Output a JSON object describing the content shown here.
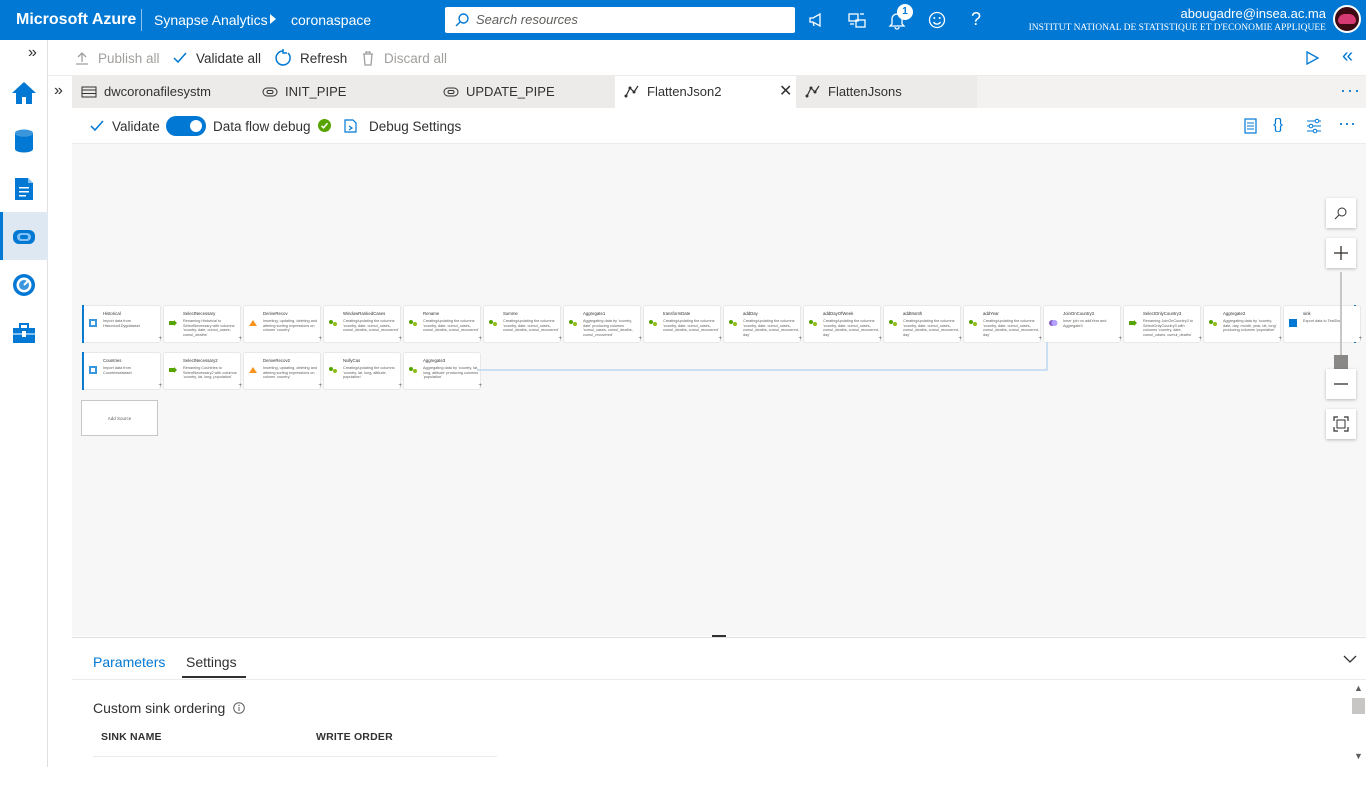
{
  "topbar": {
    "brand": "Microsoft Azure",
    "service": "Synapse Analytics",
    "workspace": "coronaspace",
    "search_placeholder": "Search resources",
    "notification_count": "1",
    "user_email": "abougadre@insea.ac.ma",
    "user_org": "INSTITUT NATIONAL DE STATISTIQUE ET D'ECONOMIE APPLIQUEE",
    "help_label": "?"
  },
  "commands": {
    "publish_all": "Publish all",
    "validate_all": "Validate all",
    "refresh": "Refresh",
    "discard_all": "Discard all"
  },
  "tabs": [
    {
      "label": "dwcoronafilesystm",
      "icon": "dataset-icon",
      "active": false
    },
    {
      "label": "INIT_PIPE",
      "icon": "pipeline-icon",
      "active": false
    },
    {
      "label": "UPDATE_PIPE",
      "icon": "pipeline-icon",
      "active": false
    },
    {
      "label": "FlattenJson2",
      "icon": "dataflow-icon",
      "active": true
    },
    {
      "label": "FlattenJsons",
      "icon": "dataflow-icon",
      "active": false
    }
  ],
  "dataflow_toolbar": {
    "validate": "Validate",
    "debug_label": "Data flow debug",
    "debug_on": true,
    "debug_settings": "Debug Settings"
  },
  "flow_row1": [
    {
      "name": "Historical",
      "desc": "Import data from Historical1Dygdataset"
    },
    {
      "name": "SelectNecessary",
      "desc": "Renaming Historical to SelectNecessary with columns 'country, date, cumul_cases, cumul_deaths'"
    },
    {
      "name": "DeriveRecov",
      "desc": "Inserting, updating, deleting and altering sorting expressions on column 'country'"
    },
    {
      "name": "WindowRankedCases",
      "desc": "Creating/updating the columns 'country, date, cumul_cases, cumul_deaths, cumul_recovered'"
    },
    {
      "name": "Rename",
      "desc": "Creating/updating the columns 'country, date, cumul_cases, cumul_deaths, cumul_recovered'"
    },
    {
      "name": "Summe",
      "desc": "Creating/updating the columns 'country, date, cumul_cases, cumul_deaths, cumul_recovered'"
    },
    {
      "name": "Aggregate1",
      "desc": "Aggregating data by 'country, date' producing columns 'cumul_cases, cumul_deaths, cumul_recovered'"
    },
    {
      "name": "transformDate",
      "desc": "Creating/updating the columns 'country, date, cumul_cases, cumul_deaths, cumul_recovered'"
    },
    {
      "name": "addDay",
      "desc": "Creating/updating the columns 'country, date, cumul_cases, cumul_deaths, cumul_recovered, day'"
    },
    {
      "name": "addDayOfWeek",
      "desc": "Creating/updating the columns 'country, date, cumul_cases, cumul_deaths, cumul_recovered, day'"
    },
    {
      "name": "addMonth",
      "desc": "Creating/updating the columns 'country, date, cumul_cases, cumul_deaths, cumul_recovered, day'"
    },
    {
      "name": "addYear",
      "desc": "Creating/updating the columns 'country, date, cumul_cases, cumul_deaths, cumul_recovered, day'"
    },
    {
      "name": "JoinOnCountry3",
      "desc": "Inner join on addYear and Aggregate3"
    },
    {
      "name": "SelectOnlyCountry3",
      "desc": "Renaming JoinOnCountry3 to SelectOnlyCountry3 with columns 'country, date, cumul_cases, cumul_deaths'"
    },
    {
      "name": "Aggregate2",
      "desc": "Aggregating data by 'country, date, day, month, year, lat, long' producing columns 'population'"
    },
    {
      "name": "sink",
      "desc": "Export data to TestDw"
    }
  ],
  "flow_row2": [
    {
      "name": "Countries",
      "desc": "Import data from Countriesdataset"
    },
    {
      "name": "SelectNecessary2",
      "desc": "Renaming Countries to SelectNecessary2 with columns 'country, lat, long, population'"
    },
    {
      "name": "DeriveRecov2",
      "desc": "Inserting, updating, deleting and altering sorting expressions on column 'country'"
    },
    {
      "name": "NullyCas",
      "desc": "Creating/updating the columns 'country, lat, long, altitude, population'"
    },
    {
      "name": "Aggregate3",
      "desc": "Aggregating data by 'country, lat, long, altitude' producing columns 'population'"
    }
  ],
  "add_source": "Add Source",
  "bottom_panel": {
    "tabs": [
      "Parameters",
      "Settings"
    ],
    "active_tab": "Settings",
    "custom_sink_ordering": "Custom sink ordering",
    "col_sink_name": "SINK NAME",
    "col_write_order": "WRITE ORDER"
  },
  "colors": {
    "accent": "#0078d4",
    "debug_ok": "#57a300"
  }
}
